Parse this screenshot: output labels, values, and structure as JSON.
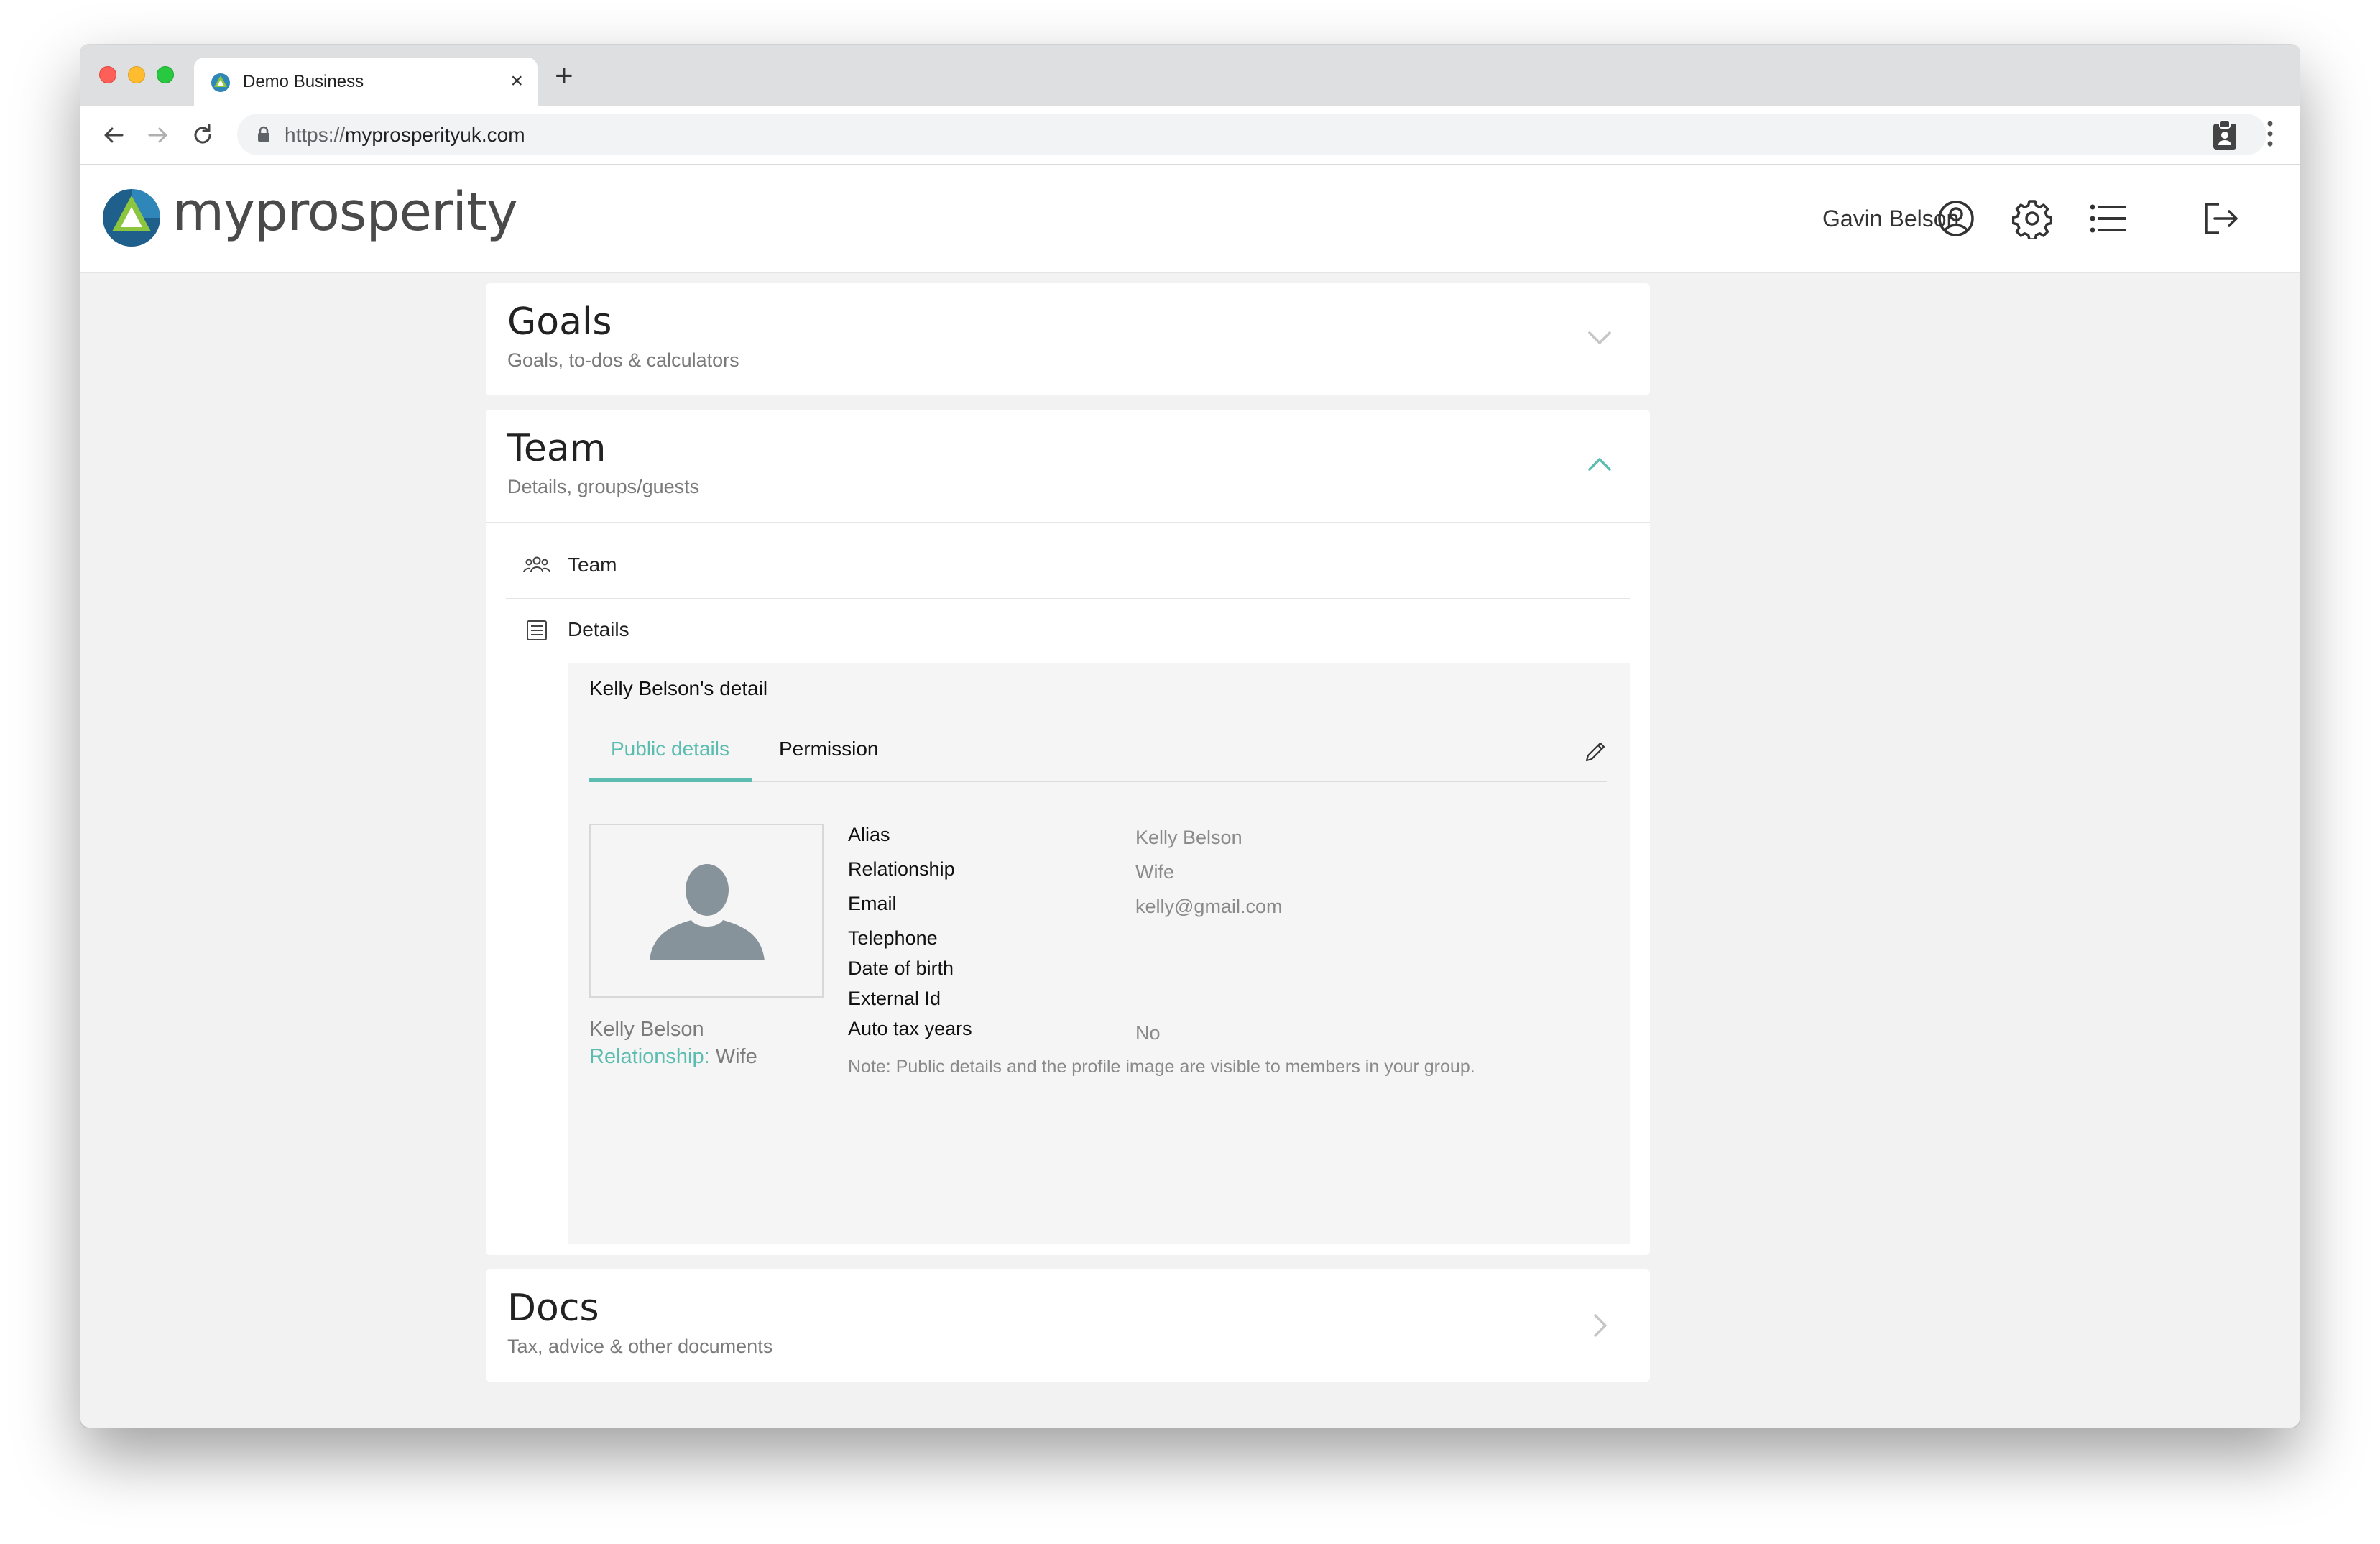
{
  "browser": {
    "tab_title": "Demo Business",
    "tab_close": "×",
    "new_tab": "+",
    "url_scheme": "https://",
    "url_host": "myprosperityuk.com"
  },
  "header": {
    "logo_text": "myprosperity",
    "user_name": "Gavin Belson"
  },
  "goals": {
    "title": "Goals",
    "subtitle": "Goals, to-dos & calculators"
  },
  "team": {
    "title": "Team",
    "subtitle": "Details, groups/guests",
    "rows": [
      {
        "label": "Team"
      },
      {
        "label": "Details"
      }
    ]
  },
  "detail": {
    "heading": "Kelly Belson's detail",
    "tabs": [
      "Public details",
      "Permission"
    ],
    "active_tab": "Public details",
    "avatar_name": "Kelly Belson",
    "avatar_relationship_key": "Relationship:",
    "avatar_relationship_value": "Wife",
    "fields": [
      {
        "label": "Alias",
        "value": "Kelly Belson"
      },
      {
        "label": "Relationship",
        "value": "Wife"
      },
      {
        "label": "Email",
        "value": "kelly@gmail.com"
      },
      {
        "label": "Telephone",
        "value": ""
      },
      {
        "label": "Date of birth",
        "value": ""
      },
      {
        "label": "External Id",
        "value": ""
      },
      {
        "label": "Auto tax years",
        "value": "No"
      }
    ],
    "note": "Note: Public details and the profile image are visible to members in your group."
  },
  "docs": {
    "title": "Docs",
    "subtitle": "Tax, advice & other documents"
  },
  "colors": {
    "accent": "#5bbdb0",
    "logo_blue": "#2f86b8",
    "logo_green": "#8cc63f",
    "window_bg": "#f2f2f2"
  }
}
